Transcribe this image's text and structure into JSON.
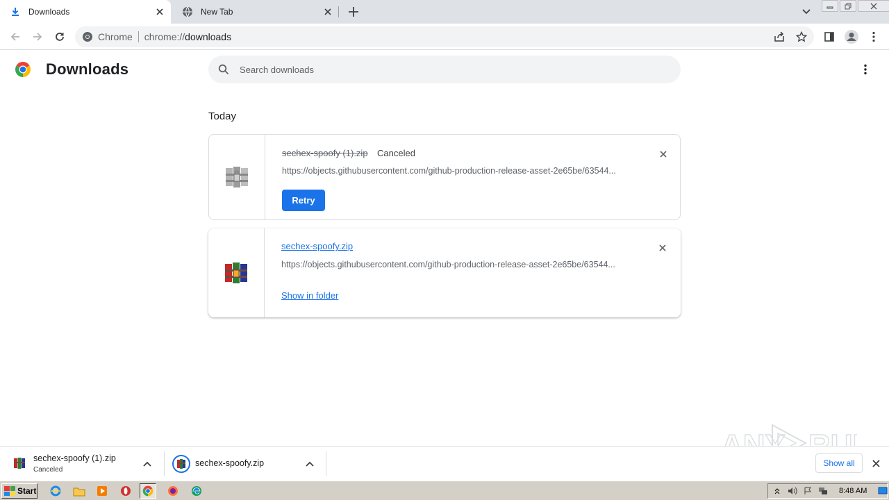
{
  "tabs": [
    {
      "title": "Downloads",
      "icon": "download-icon",
      "active": true
    },
    {
      "title": "New Tab",
      "icon": "globe-icon",
      "active": false
    }
  ],
  "omnibox": {
    "site_label": "Chrome",
    "url_scheme": "chrome://",
    "url_path": "downloads"
  },
  "page": {
    "title": "Downloads",
    "search_placeholder": "Search downloads",
    "date_heading": "Today"
  },
  "downloads": [
    {
      "filename": "sechex-spoofy (1).zip",
      "status": "Canceled",
      "url": "https://objects.githubusercontent.com/github-production-release-asset-2e65be/63544...",
      "action": "Retry"
    },
    {
      "filename": "sechex-spoofy.zip",
      "url": "https://objects.githubusercontent.com/github-production-release-asset-2e65be/63544...",
      "action": "Show in folder"
    }
  ],
  "shelf": {
    "items": [
      {
        "name": "sechex-spoofy (1).zip",
        "status": "Canceled"
      },
      {
        "name": "sechex-spoofy.zip"
      }
    ],
    "show_all": "Show all"
  },
  "watermark": {
    "text_left": "ANY",
    "text_right": "RUN"
  },
  "taskbar": {
    "start_label": "Start",
    "clock": "8:48 AM"
  },
  "colors": {
    "accent": "#1a73e8",
    "tabstrip": "#dee1e6",
    "omnibox": "#f1f3f4",
    "taskbar": "#d4d0c8"
  }
}
